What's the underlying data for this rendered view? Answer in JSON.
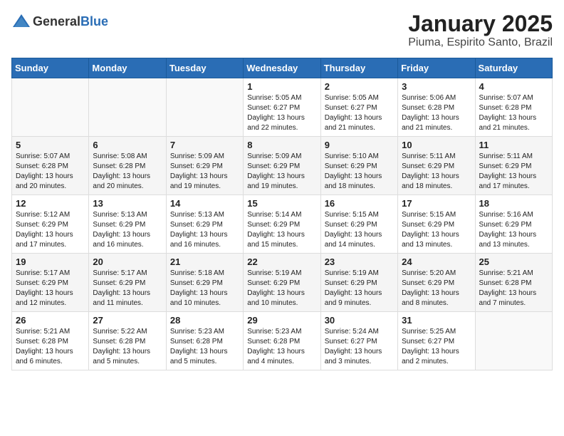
{
  "header": {
    "logo_general": "General",
    "logo_blue": "Blue",
    "title": "January 2025",
    "subtitle": "Piuma, Espirito Santo, Brazil"
  },
  "weekdays": [
    "Sunday",
    "Monday",
    "Tuesday",
    "Wednesday",
    "Thursday",
    "Friday",
    "Saturday"
  ],
  "weeks": [
    [
      {
        "day": "",
        "info": ""
      },
      {
        "day": "",
        "info": ""
      },
      {
        "day": "",
        "info": ""
      },
      {
        "day": "1",
        "info": "Sunrise: 5:05 AM\nSunset: 6:27 PM\nDaylight: 13 hours\nand 22 minutes."
      },
      {
        "day": "2",
        "info": "Sunrise: 5:05 AM\nSunset: 6:27 PM\nDaylight: 13 hours\nand 21 minutes."
      },
      {
        "day": "3",
        "info": "Sunrise: 5:06 AM\nSunset: 6:28 PM\nDaylight: 13 hours\nand 21 minutes."
      },
      {
        "day": "4",
        "info": "Sunrise: 5:07 AM\nSunset: 6:28 PM\nDaylight: 13 hours\nand 21 minutes."
      }
    ],
    [
      {
        "day": "5",
        "info": "Sunrise: 5:07 AM\nSunset: 6:28 PM\nDaylight: 13 hours\nand 20 minutes."
      },
      {
        "day": "6",
        "info": "Sunrise: 5:08 AM\nSunset: 6:28 PM\nDaylight: 13 hours\nand 20 minutes."
      },
      {
        "day": "7",
        "info": "Sunrise: 5:09 AM\nSunset: 6:29 PM\nDaylight: 13 hours\nand 19 minutes."
      },
      {
        "day": "8",
        "info": "Sunrise: 5:09 AM\nSunset: 6:29 PM\nDaylight: 13 hours\nand 19 minutes."
      },
      {
        "day": "9",
        "info": "Sunrise: 5:10 AM\nSunset: 6:29 PM\nDaylight: 13 hours\nand 18 minutes."
      },
      {
        "day": "10",
        "info": "Sunrise: 5:11 AM\nSunset: 6:29 PM\nDaylight: 13 hours\nand 18 minutes."
      },
      {
        "day": "11",
        "info": "Sunrise: 5:11 AM\nSunset: 6:29 PM\nDaylight: 13 hours\nand 17 minutes."
      }
    ],
    [
      {
        "day": "12",
        "info": "Sunrise: 5:12 AM\nSunset: 6:29 PM\nDaylight: 13 hours\nand 17 minutes."
      },
      {
        "day": "13",
        "info": "Sunrise: 5:13 AM\nSunset: 6:29 PM\nDaylight: 13 hours\nand 16 minutes."
      },
      {
        "day": "14",
        "info": "Sunrise: 5:13 AM\nSunset: 6:29 PM\nDaylight: 13 hours\nand 16 minutes."
      },
      {
        "day": "15",
        "info": "Sunrise: 5:14 AM\nSunset: 6:29 PM\nDaylight: 13 hours\nand 15 minutes."
      },
      {
        "day": "16",
        "info": "Sunrise: 5:15 AM\nSunset: 6:29 PM\nDaylight: 13 hours\nand 14 minutes."
      },
      {
        "day": "17",
        "info": "Sunrise: 5:15 AM\nSunset: 6:29 PM\nDaylight: 13 hours\nand 13 minutes."
      },
      {
        "day": "18",
        "info": "Sunrise: 5:16 AM\nSunset: 6:29 PM\nDaylight: 13 hours\nand 13 minutes."
      }
    ],
    [
      {
        "day": "19",
        "info": "Sunrise: 5:17 AM\nSunset: 6:29 PM\nDaylight: 13 hours\nand 12 minutes."
      },
      {
        "day": "20",
        "info": "Sunrise: 5:17 AM\nSunset: 6:29 PM\nDaylight: 13 hours\nand 11 minutes."
      },
      {
        "day": "21",
        "info": "Sunrise: 5:18 AM\nSunset: 6:29 PM\nDaylight: 13 hours\nand 10 minutes."
      },
      {
        "day": "22",
        "info": "Sunrise: 5:19 AM\nSunset: 6:29 PM\nDaylight: 13 hours\nand 10 minutes."
      },
      {
        "day": "23",
        "info": "Sunrise: 5:19 AM\nSunset: 6:29 PM\nDaylight: 13 hours\nand 9 minutes."
      },
      {
        "day": "24",
        "info": "Sunrise: 5:20 AM\nSunset: 6:29 PM\nDaylight: 13 hours\nand 8 minutes."
      },
      {
        "day": "25",
        "info": "Sunrise: 5:21 AM\nSunset: 6:28 PM\nDaylight: 13 hours\nand 7 minutes."
      }
    ],
    [
      {
        "day": "26",
        "info": "Sunrise: 5:21 AM\nSunset: 6:28 PM\nDaylight: 13 hours\nand 6 minutes."
      },
      {
        "day": "27",
        "info": "Sunrise: 5:22 AM\nSunset: 6:28 PM\nDaylight: 13 hours\nand 5 minutes."
      },
      {
        "day": "28",
        "info": "Sunrise: 5:23 AM\nSunset: 6:28 PM\nDaylight: 13 hours\nand 5 minutes."
      },
      {
        "day": "29",
        "info": "Sunrise: 5:23 AM\nSunset: 6:28 PM\nDaylight: 13 hours\nand 4 minutes."
      },
      {
        "day": "30",
        "info": "Sunrise: 5:24 AM\nSunset: 6:27 PM\nDaylight: 13 hours\nand 3 minutes."
      },
      {
        "day": "31",
        "info": "Sunrise: 5:25 AM\nSunset: 6:27 PM\nDaylight: 13 hours\nand 2 minutes."
      },
      {
        "day": "",
        "info": ""
      }
    ]
  ]
}
